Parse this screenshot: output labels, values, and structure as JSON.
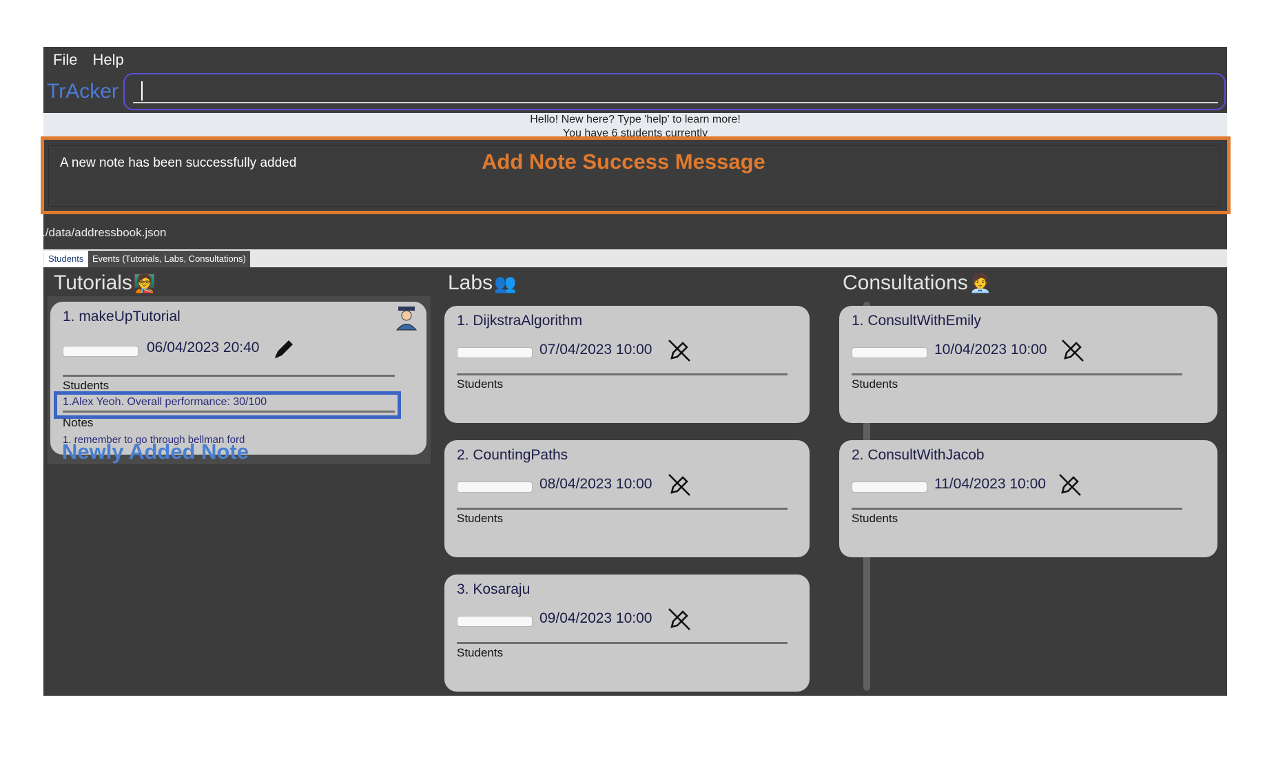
{
  "menu": {
    "file": "File",
    "help": "Help"
  },
  "app_title": "TrAcker",
  "command": {
    "value": "",
    "placeholder": ""
  },
  "welcome": {
    "line1": "Hello! New here? Type 'help' to learn more!",
    "line2": "You have 6 students currently"
  },
  "result": {
    "message": "A new note has been successfully added"
  },
  "annotations": {
    "success_label": "Add Note Success Message",
    "note_label": "Newly Added Note",
    "success_color": "#e07a2e",
    "note_color": "#3b64c4"
  },
  "status": {
    "path": "./data/addressbook.json"
  },
  "tabs": {
    "students": "Students",
    "events": "Events (Tutorials, Labs, Consultations)"
  },
  "columns": {
    "tutorials": "Tutorials",
    "labs": "Labs",
    "consultations": "Consultations"
  },
  "tutorial": {
    "index": "1.",
    "name": "makeUpTutorial",
    "date": "06/04/2023 20:40",
    "students_label": "Students",
    "student_line": "1.Alex Yeoh. Overall performance: 30/100",
    "notes_label": "Notes",
    "note_line": "1. remember to go through bellman ford"
  },
  "labs": [
    {
      "index": "1.",
      "name": "DijkstraAlgorithm",
      "date": "07/04/2023 10:00",
      "students_label": "Students"
    },
    {
      "index": "2.",
      "name": "CountingPaths",
      "date": "08/04/2023 10:00",
      "students_label": "Students"
    },
    {
      "index": "3.",
      "name": "Kosaraju",
      "date": "09/04/2023 10:00",
      "students_label": "Students"
    }
  ],
  "consultations": [
    {
      "index": "1.",
      "name": "ConsultWithEmily",
      "date": "10/04/2023 10:00",
      "students_label": "Students"
    },
    {
      "index": "2.",
      "name": "ConsultWithJacob",
      "date": "11/04/2023 10:00",
      "students_label": "Students"
    }
  ],
  "colors": {
    "accent": "#4d7bd6",
    "panel": "#3c3c3c",
    "card": "#c9c9c9"
  }
}
